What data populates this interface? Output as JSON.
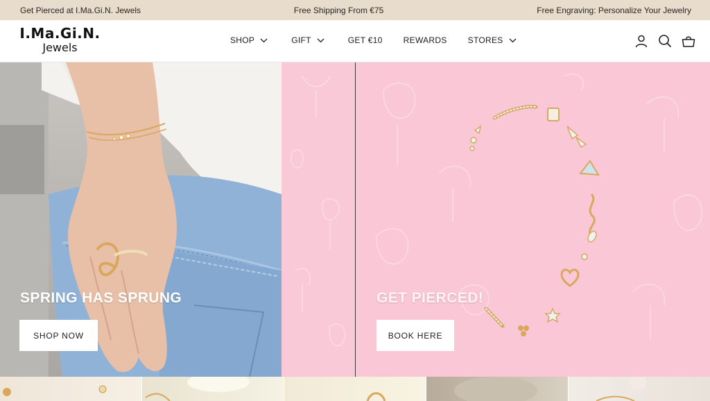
{
  "announcement": {
    "left": "Get Pierced at I.Ma.Gi.N. Jewels",
    "center": "Free Shipping From €75",
    "right": "Free Engraving: Personalize Your Jewelry"
  },
  "logo": {
    "main": "I.Ma.Gi.N.",
    "sub": "Jewels"
  },
  "nav": [
    {
      "label": "SHOP",
      "dropdown": true
    },
    {
      "label": "GIFT",
      "dropdown": true
    },
    {
      "label": "GET €10",
      "dropdown": false
    },
    {
      "label": "REWARDS",
      "dropdown": false
    },
    {
      "label": "STORES",
      "dropdown": true
    }
  ],
  "header_icons": [
    "account-icon",
    "search-icon",
    "cart-icon"
  ],
  "hero": {
    "left": {
      "title": "SPRING HAS SPRUNG",
      "button": "SHOP NOW"
    },
    "right": {
      "title": "GET PIERCED!",
      "button": "BOOK HERE"
    }
  },
  "colors": {
    "announcement_bg": "#e8dccd",
    "hero_pink": "#f9c7d6",
    "text_dark": "#1c1b1b"
  },
  "tiles": [
    "product-tile-1",
    "product-tile-2",
    "product-tile-3",
    "product-tile-4",
    "product-tile-5"
  ]
}
